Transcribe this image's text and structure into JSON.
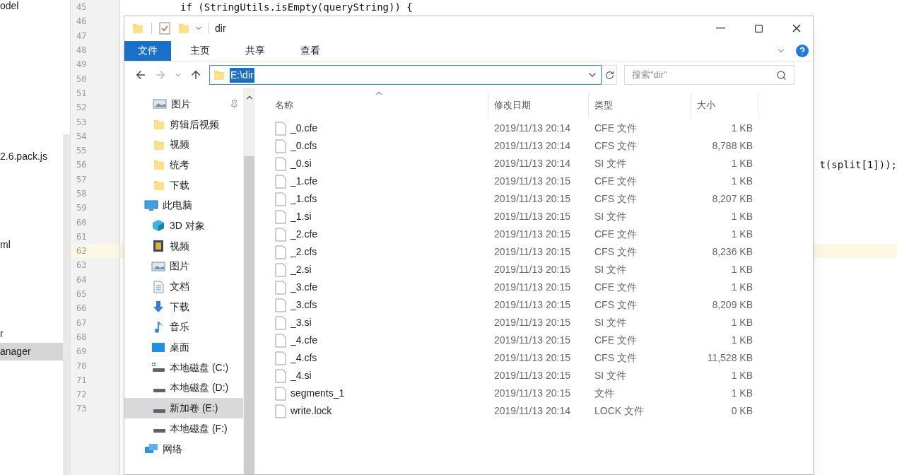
{
  "project_panel": {
    "items": [
      {
        "text": "odel",
        "selected": false
      },
      {
        "text": "2.6.pack.js",
        "selected": false
      },
      {
        "text": "ml",
        "selected": false
      },
      {
        "text": "r",
        "selected": false
      },
      {
        "text": "anager",
        "selected": true
      }
    ]
  },
  "editor": {
    "lines": [
      {
        "number": "45",
        "text": "if (StringUtils.isEmpty(queryString)) {",
        "kind": "code",
        "current": false
      },
      {
        "number": "46",
        "current": false
      },
      {
        "number": "47",
        "current": false
      },
      {
        "number": "48",
        "current": false
      },
      {
        "number": "49",
        "current": false
      },
      {
        "number": "50",
        "current": false
      },
      {
        "number": "51",
        "current": false
      },
      {
        "number": "52",
        "current": false
      },
      {
        "number": "53",
        "current": false
      },
      {
        "number": "54",
        "current": false
      },
      {
        "number": "55",
        "current": false
      },
      {
        "number": "56",
        "text": "t(split[1]));",
        "kind": "tail",
        "current": false
      },
      {
        "number": "57",
        "current": false
      },
      {
        "number": "58",
        "current": false
      },
      {
        "number": "59",
        "current": false
      },
      {
        "number": "60",
        "current": false
      },
      {
        "number": "61",
        "current": false
      },
      {
        "number": "62",
        "current": true
      },
      {
        "number": "63",
        "current": false
      },
      {
        "number": "64",
        "current": false
      },
      {
        "number": "65",
        "current": false
      },
      {
        "number": "66",
        "current": false
      },
      {
        "number": "67",
        "current": false
      },
      {
        "number": "68",
        "current": false
      },
      {
        "number": "69",
        "current": false
      },
      {
        "number": "70",
        "current": false
      },
      {
        "number": "71",
        "current": false
      },
      {
        "number": "72",
        "current": false
      },
      {
        "number": "73",
        "current": false
      }
    ]
  },
  "explorer": {
    "title": "dir",
    "ribbon_tabs": [
      {
        "label": "文件",
        "selected": true
      },
      {
        "label": "主页",
        "selected": false
      },
      {
        "label": "共享",
        "selected": false
      },
      {
        "label": "查看",
        "selected": false
      }
    ],
    "address": "E:\\dir",
    "search_placeholder": "搜索\"dir\"",
    "quick_access": [
      {
        "label": "图片",
        "kind": "picture",
        "pinned": true
      },
      {
        "label": "剪辑后视频",
        "kind": "folder",
        "pinned": false
      },
      {
        "label": "视频",
        "kind": "folder",
        "pinned": false
      },
      {
        "label": "统考",
        "kind": "folder",
        "pinned": false
      },
      {
        "label": "下载",
        "kind": "folder",
        "pinned": false
      }
    ],
    "nav_tree": [
      {
        "label": "此电脑",
        "kind": "pc",
        "selected": false,
        "children": [
          {
            "label": "3D 对象",
            "kind": "cube",
            "selected": false
          },
          {
            "label": "视频",
            "kind": "video",
            "selected": false
          },
          {
            "label": "图片",
            "kind": "picture",
            "selected": false
          },
          {
            "label": "文档",
            "kind": "document",
            "selected": false
          },
          {
            "label": "下载",
            "kind": "download",
            "selected": false
          },
          {
            "label": "音乐",
            "kind": "music",
            "selected": false
          },
          {
            "label": "桌面",
            "kind": "desktop",
            "selected": false
          },
          {
            "label": "本地磁盘 (C:)",
            "kind": "system-drive",
            "selected": false
          },
          {
            "label": "本地磁盘 (D:)",
            "kind": "drive",
            "selected": false
          },
          {
            "label": "新加卷 (E:)",
            "kind": "drive",
            "selected": true
          },
          {
            "label": "本地磁盘 (F:)",
            "kind": "drive",
            "selected": false
          }
        ]
      },
      {
        "label": "网络",
        "kind": "network",
        "selected": false
      }
    ],
    "columns": [
      "名称",
      "修改日期",
      "类型",
      "大小"
    ],
    "files": [
      {
        "name": "_0.cfe",
        "date": "2019/11/13 20:14",
        "type": "CFE 文件",
        "size": "1 KB"
      },
      {
        "name": "_0.cfs",
        "date": "2019/11/13 20:14",
        "type": "CFS 文件",
        "size": "8,788 KB"
      },
      {
        "name": "_0.si",
        "date": "2019/11/13 20:14",
        "type": "SI 文件",
        "size": "1 KB"
      },
      {
        "name": "_1.cfe",
        "date": "2019/11/13 20:15",
        "type": "CFE 文件",
        "size": "1 KB"
      },
      {
        "name": "_1.cfs",
        "date": "2019/11/13 20:15",
        "type": "CFS 文件",
        "size": "8,207 KB"
      },
      {
        "name": "_1.si",
        "date": "2019/11/13 20:15",
        "type": "SI 文件",
        "size": "1 KB"
      },
      {
        "name": "_2.cfe",
        "date": "2019/11/13 20:15",
        "type": "CFE 文件",
        "size": "1 KB"
      },
      {
        "name": "_2.cfs",
        "date": "2019/11/13 20:15",
        "type": "CFS 文件",
        "size": "8,236 KB"
      },
      {
        "name": "_2.si",
        "date": "2019/11/13 20:15",
        "type": "SI 文件",
        "size": "1 KB"
      },
      {
        "name": "_3.cfe",
        "date": "2019/11/13 20:15",
        "type": "CFE 文件",
        "size": "1 KB"
      },
      {
        "name": "_3.cfs",
        "date": "2019/11/13 20:15",
        "type": "CFS 文件",
        "size": "8,209 KB"
      },
      {
        "name": "_3.si",
        "date": "2019/11/13 20:15",
        "type": "SI 文件",
        "size": "1 KB"
      },
      {
        "name": "_4.cfe",
        "date": "2019/11/13 20:15",
        "type": "CFE 文件",
        "size": "1 KB"
      },
      {
        "name": "_4.cfs",
        "date": "2019/11/13 20:15",
        "type": "CFS 文件",
        "size": "11,528 KB"
      },
      {
        "name": "_4.si",
        "date": "2019/11/13 20:15",
        "type": "SI 文件",
        "size": "1 KB"
      },
      {
        "name": "segments_1",
        "date": "2019/11/13 20:15",
        "type": "文件",
        "size": "1 KB"
      },
      {
        "name": "write.lock",
        "date": "2019/11/13 20:14",
        "type": "LOCK 文件",
        "size": "0 KB"
      }
    ]
  }
}
